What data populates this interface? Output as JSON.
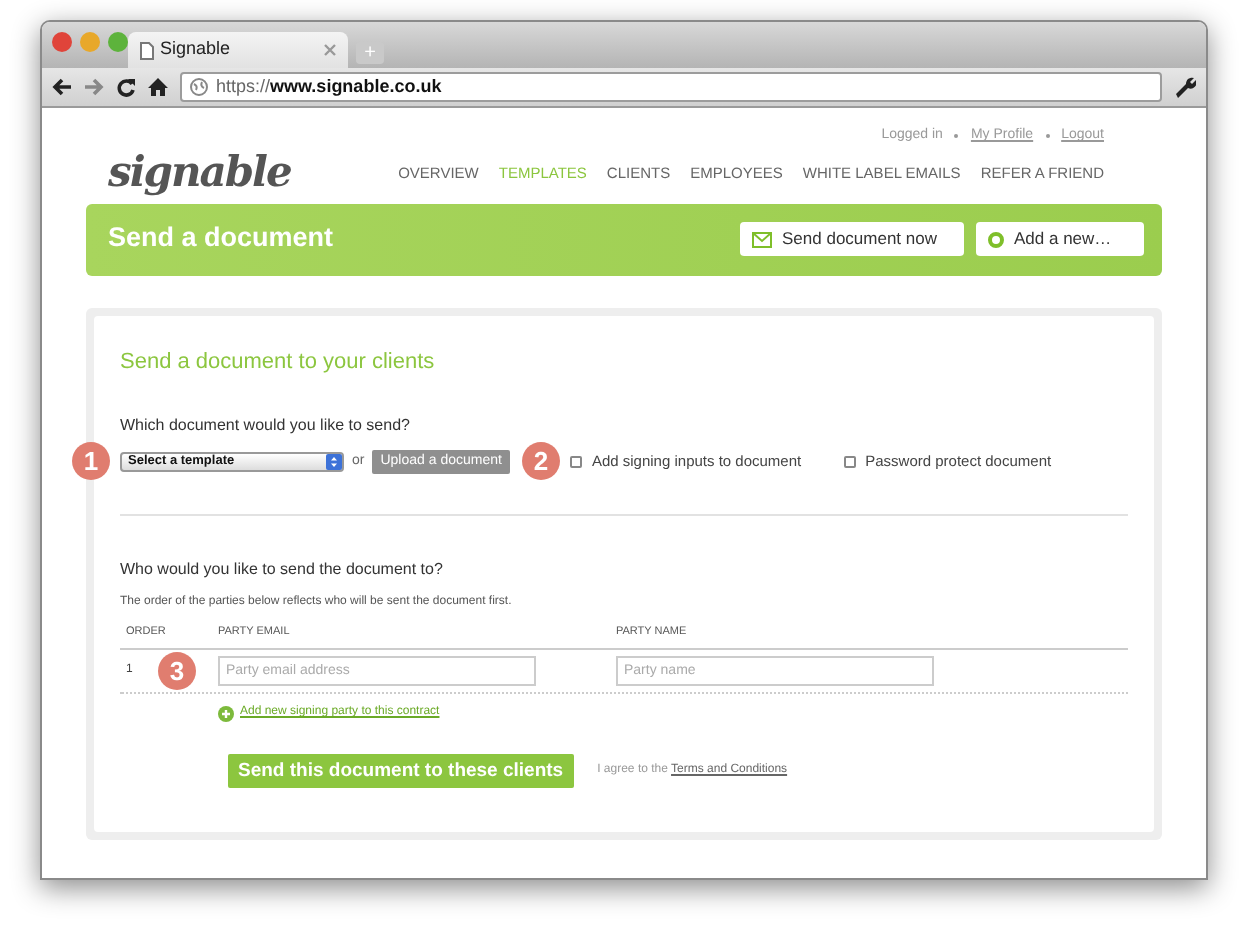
{
  "browser": {
    "tab_title": "Signable",
    "new_tab": "+",
    "url_scheme": "https://",
    "url_host": "www.signable.co.uk"
  },
  "header": {
    "logo": "signable",
    "account_links": [
      {
        "label": "Logged in",
        "kind": "text"
      },
      {
        "label": "My Profile",
        "kind": "link"
      },
      {
        "label": "Logout",
        "kind": "link"
      }
    ],
    "nav": [
      {
        "label": "OVERVIEW",
        "selected": false
      },
      {
        "label": "TEMPLATES",
        "selected": true
      },
      {
        "label": "CLIENTS",
        "selected": false
      },
      {
        "label": "EMPLOYEES",
        "selected": false
      },
      {
        "label": "WHITE LABEL EMAILS",
        "selected": false
      },
      {
        "label": "REFER A FRIEND",
        "selected": false
      }
    ]
  },
  "banner": {
    "title": "Send a document",
    "buttons": [
      {
        "label": "Send document now",
        "kind": "mail"
      },
      {
        "label": "Add a new…",
        "kind": "add"
      }
    ]
  },
  "form": {
    "heading": "Send a document to your clients",
    "question_1": "Which document would you like to send?",
    "select": {
      "value": "Select a template",
      "marker": "1"
    },
    "or": "or",
    "upload": {
      "label": "Upload a document",
      "disabled": true
    },
    "options_marker": "2",
    "checkboxes": [
      {
        "label": "Add signing inputs to document",
        "checked": false
      },
      {
        "label": "Password protect document",
        "checked": false
      }
    ],
    "question_2": "Who would you like to send the document to?",
    "note": "The order of the parties below reflects who will be sent the document first.",
    "columns": [
      "ORDER",
      "PARTY EMAIL",
      "PARTY NAME"
    ],
    "rows": [
      {
        "order": "1",
        "marker": "3",
        "email_placeholder": "Party email address",
        "name_placeholder": "Party name"
      }
    ],
    "add_party": "Add new signing party to this contract",
    "submit": "Send this document to these clients",
    "agree": "I agree to the",
    "terms": "Terms and Conditions"
  }
}
